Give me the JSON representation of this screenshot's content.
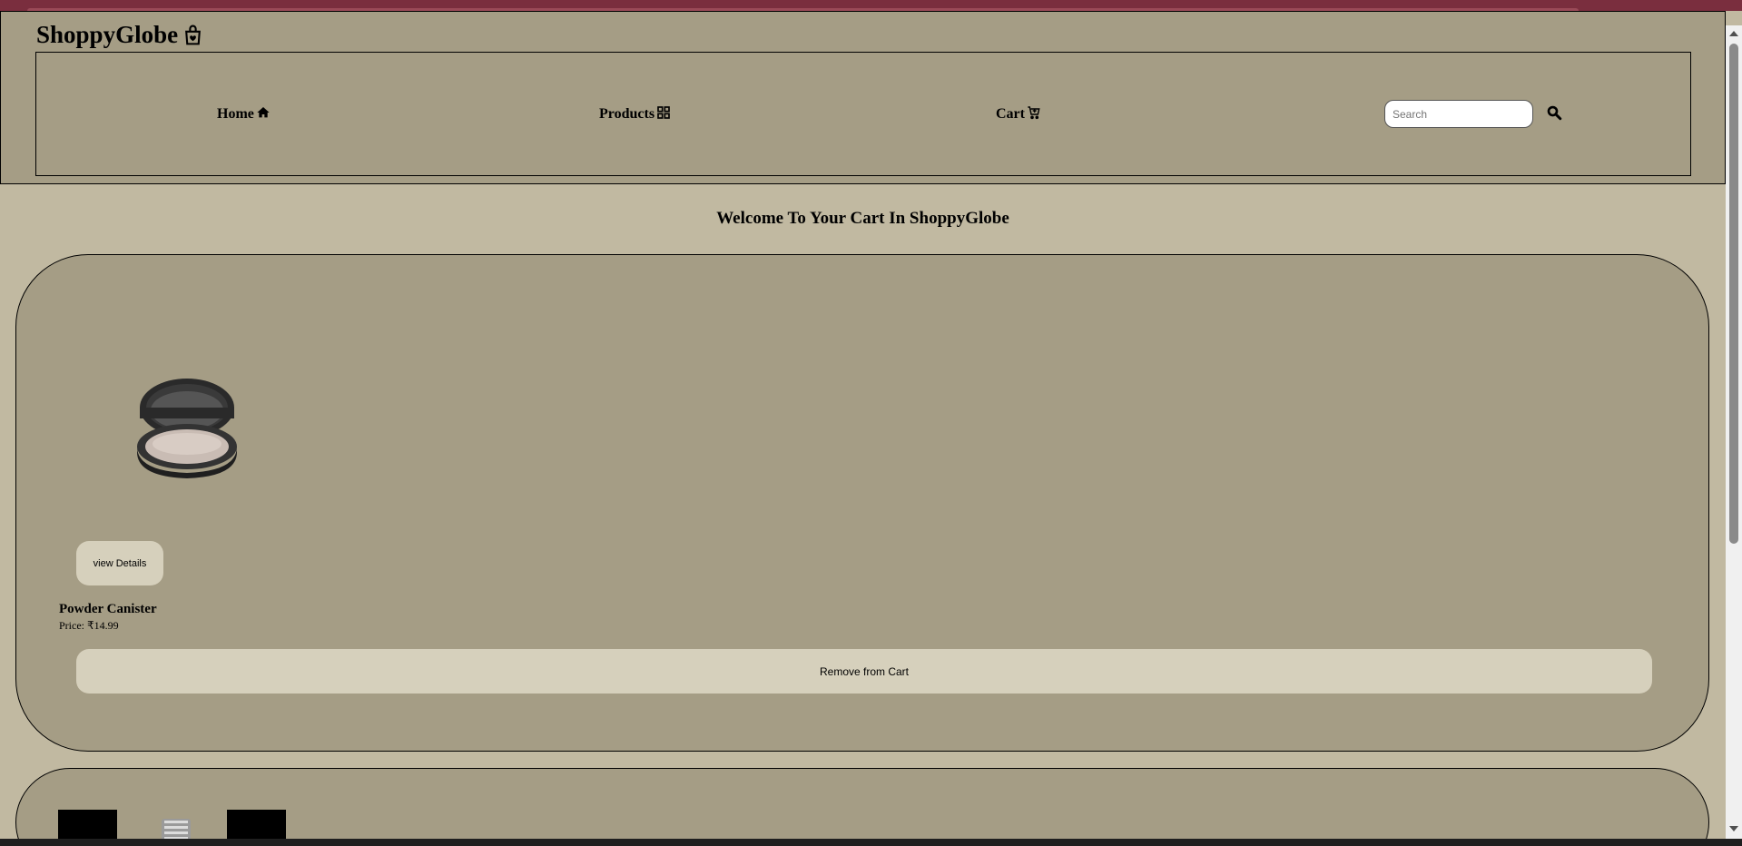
{
  "header": {
    "brand": "ShoppyGlobe",
    "nav": {
      "home": "Home",
      "products": "Products",
      "cart": "Cart"
    },
    "search": {
      "placeholder": "Search"
    }
  },
  "main": {
    "title": "Welcome To Your Cart In ShoppyGlobe",
    "cart_items": [
      {
        "name": "Powder Canister",
        "price": "Price: ₹14.99",
        "view_label": "view Details",
        "remove_label": "Remove from Cart"
      }
    ]
  },
  "colors": {
    "page_bg": "#c1b9a1",
    "header_bg": "#a59d85",
    "button_bg": "#d6d0bc",
    "top_strip": "#7a2e3e"
  },
  "icons": {
    "brand": "shopping-bag-heart-icon",
    "home": "home-icon",
    "products": "grid-icon",
    "cart": "cart-plus-icon",
    "search": "search-icon"
  }
}
